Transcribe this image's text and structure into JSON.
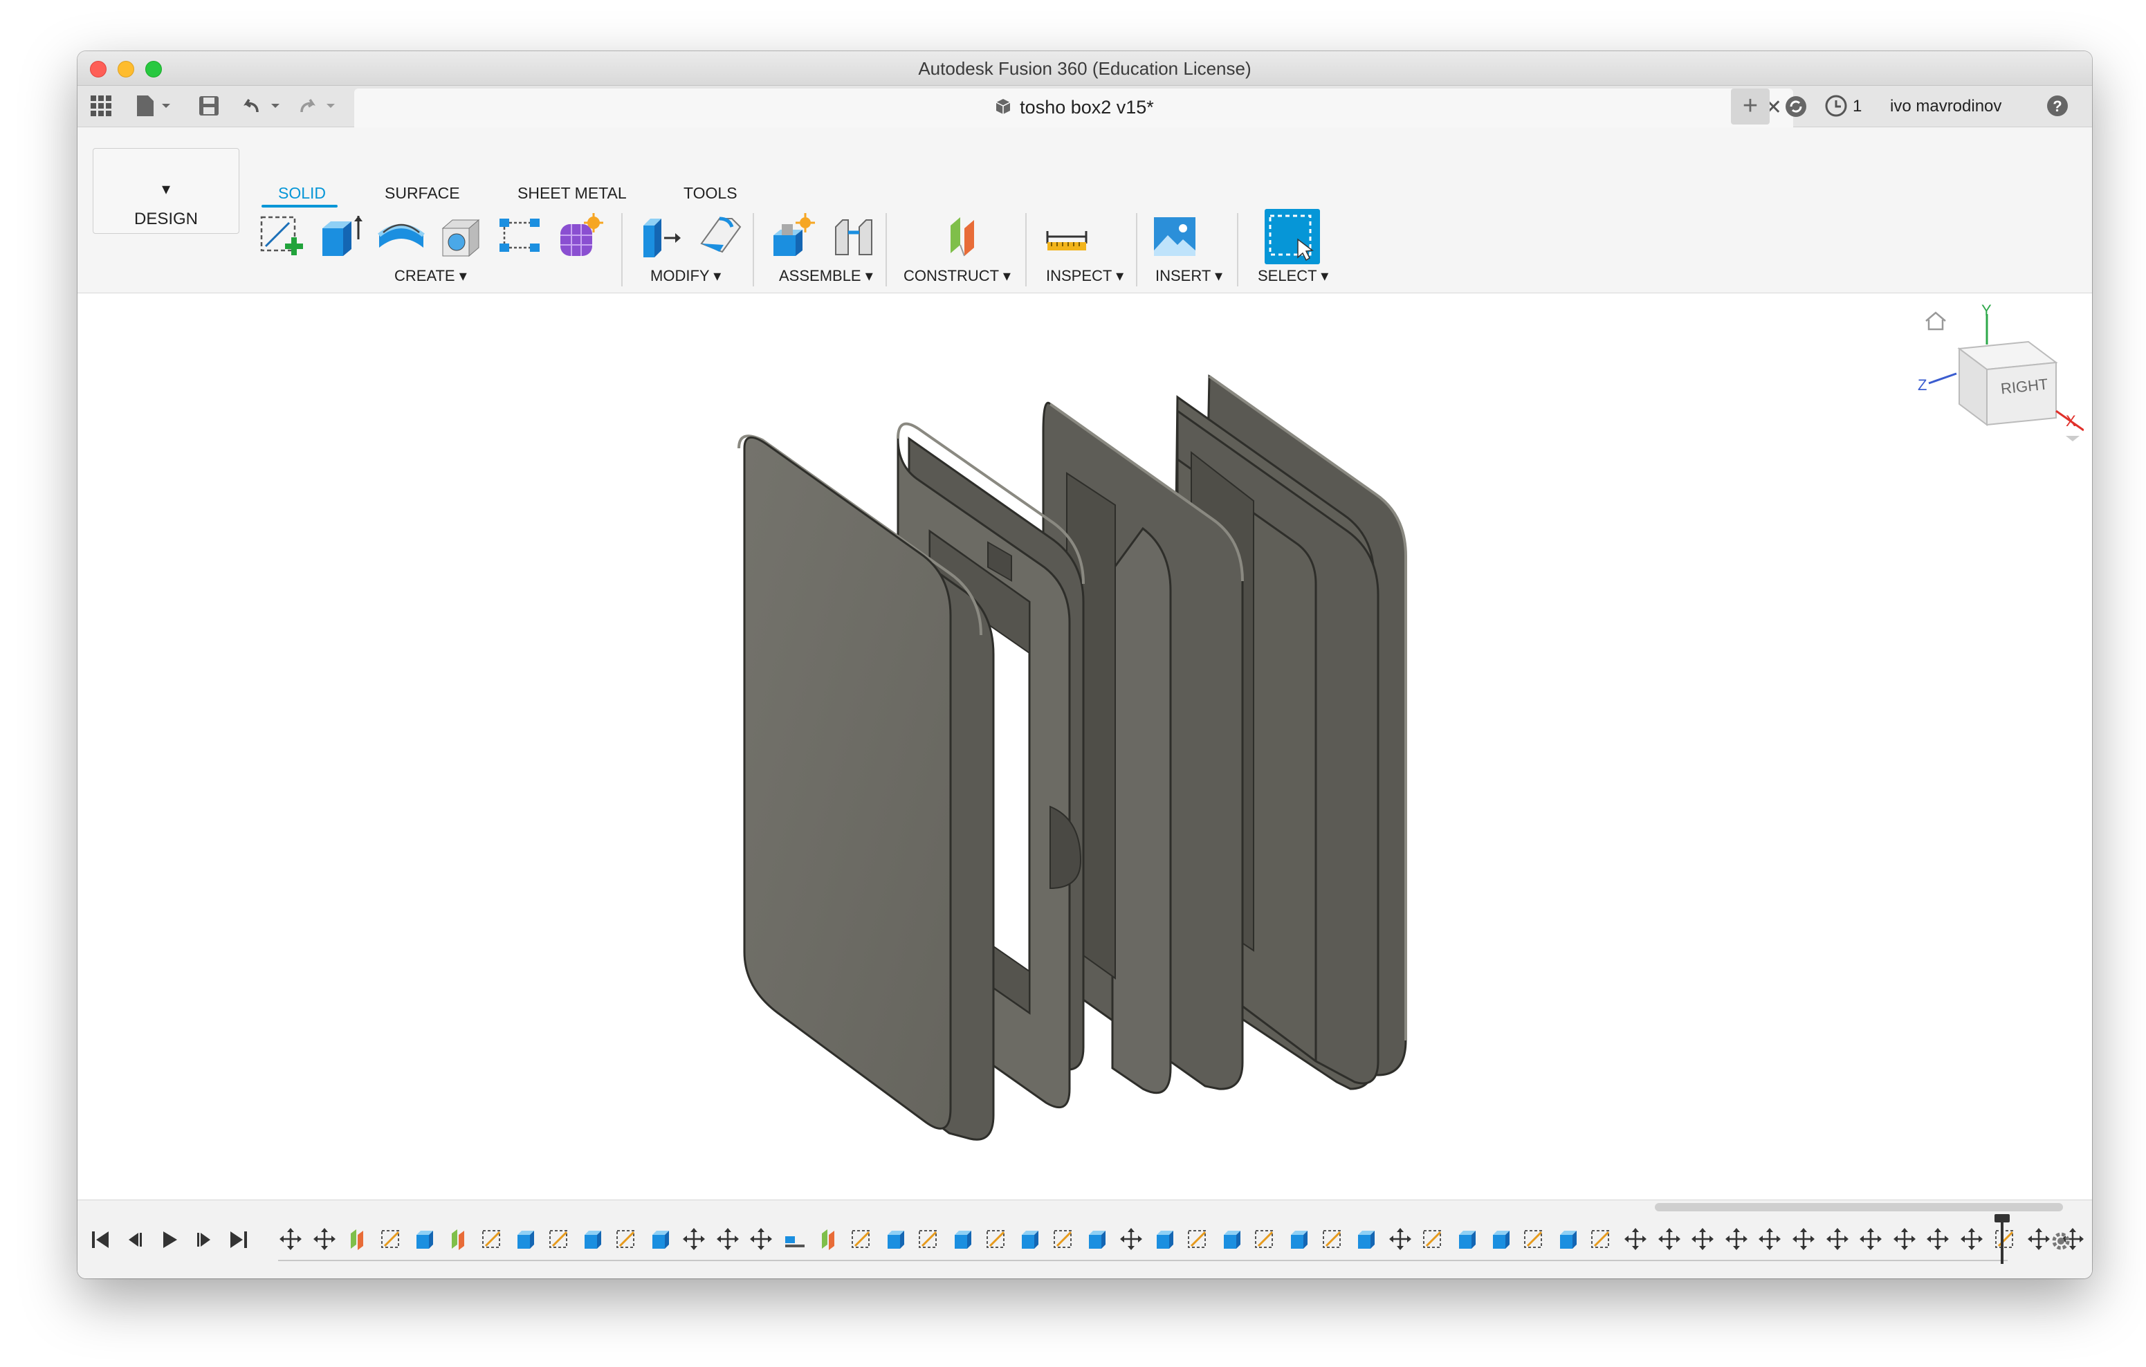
{
  "window": {
    "title": "Autodesk Fusion 360 (Education License)"
  },
  "tabbar": {
    "document_title": "tosho box2 v15*",
    "job_count": "1",
    "user_name": "ivo mavrodinov",
    "icons": [
      "grid-icon",
      "file-icon",
      "save-icon",
      "undo-icon",
      "redo-icon",
      "plus-icon",
      "refresh-icon",
      "clock-icon",
      "help-icon"
    ]
  },
  "toolbar": {
    "workspace_label": "DESIGN",
    "tabs": [
      {
        "label": "SOLID",
        "active": true
      },
      {
        "label": "SURFACE"
      },
      {
        "label": "SHEET METAL"
      },
      {
        "label": "TOOLS"
      }
    ],
    "groups": [
      {
        "label": "CREATE",
        "icons": [
          "sketch-icon",
          "extrude-icon",
          "revolve-icon",
          "hole-icon",
          "pattern-icon",
          "form-icon"
        ]
      },
      {
        "label": "MODIFY",
        "icons": [
          "press-pull-icon",
          "fillet-icon"
        ]
      },
      {
        "label": "ASSEMBLE",
        "icons": [
          "new-component-icon",
          "joint-icon"
        ]
      },
      {
        "label": "CONSTRUCT",
        "icons": [
          "offset-plane-icon"
        ]
      },
      {
        "label": "INSPECT",
        "icons": [
          "measure-icon"
        ]
      },
      {
        "label": "INSERT",
        "icons": [
          "insert-image-icon"
        ]
      },
      {
        "label": "SELECT",
        "icons": [
          "select-icon"
        ]
      }
    ],
    "accent": "#0696d7"
  },
  "viewcube": {
    "face_label": "RIGHT",
    "axes": [
      "Y",
      "Z",
      "X"
    ]
  },
  "model": {
    "color": "#6b6a63",
    "description_parts": 5
  }
}
